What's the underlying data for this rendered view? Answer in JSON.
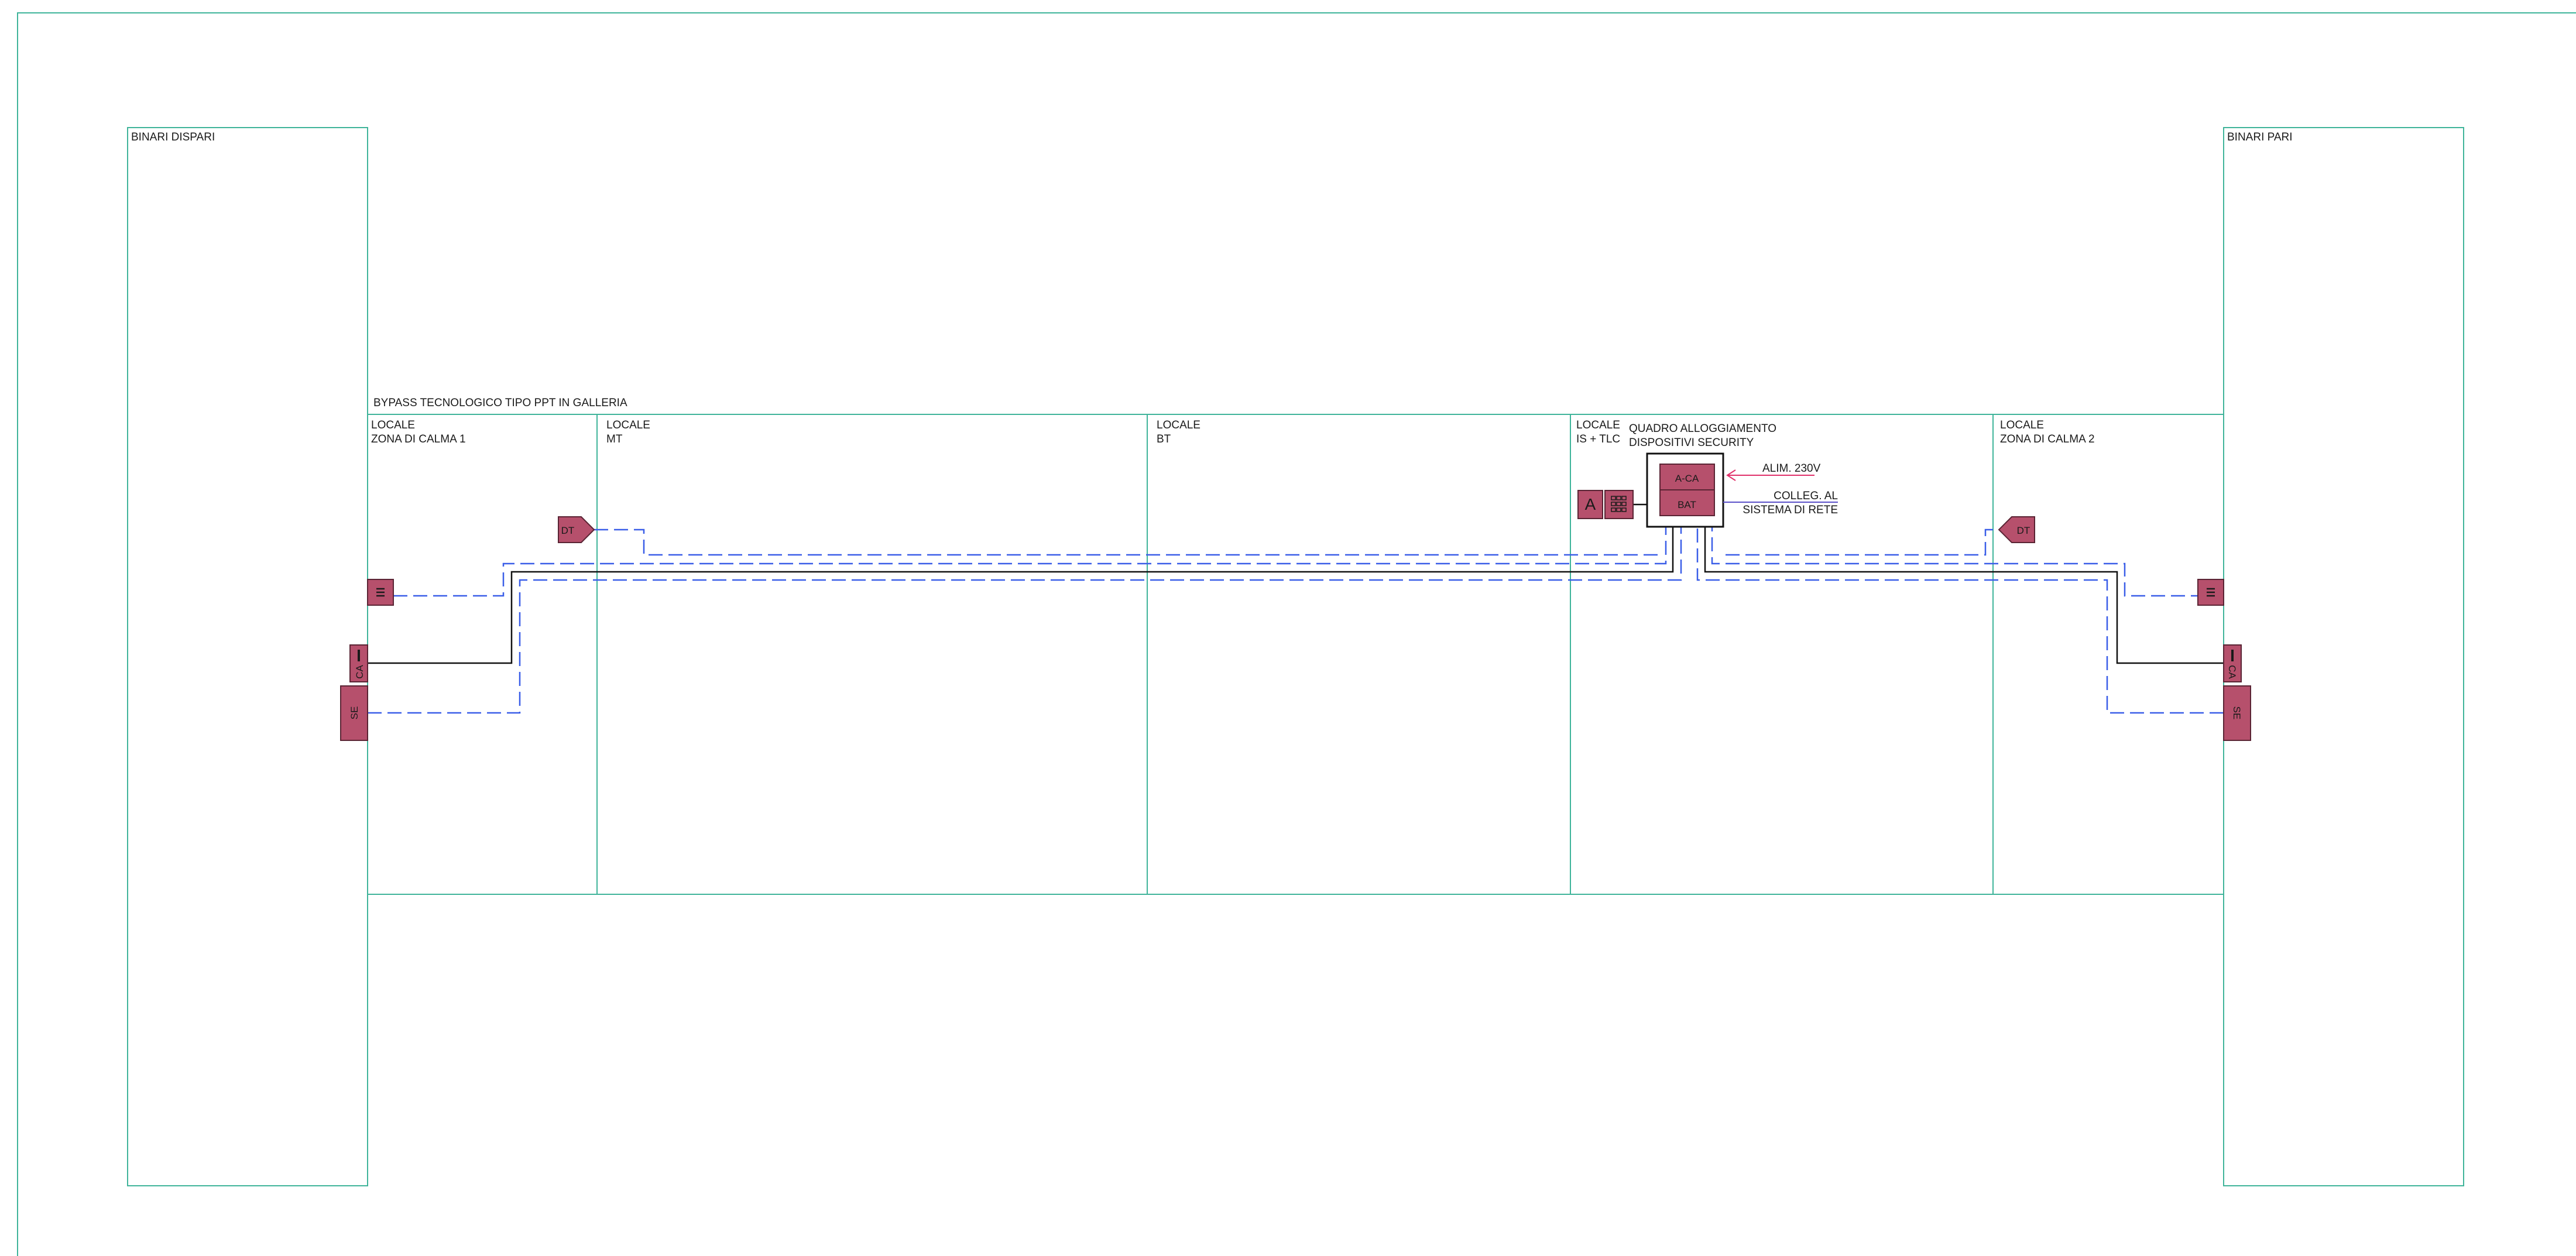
{
  "diagram": {
    "title": "BYPASS TECNOLOGICO TIPO PPT IN GALLERIA",
    "tracks": {
      "left": "BINARI DISPARI",
      "right": "BINARI PARI"
    },
    "rooms": [
      {
        "line1": "LOCALE",
        "line2": "ZONA DI CALMA 1"
      },
      {
        "line1": "LOCALE",
        "line2": "MT"
      },
      {
        "line1": "LOCALE",
        "line2": "BT"
      },
      {
        "line1": "LOCALE",
        "line2": "IS + TLC"
      },
      {
        "line1": "LOCALE",
        "line2": "ZONA DI CALMA 2"
      }
    ],
    "panel": {
      "title_line1": "QUADRO ALLOGGIAMENTO",
      "title_line2": "DISPOSITIVI SECURITY",
      "aca": "A-CA",
      "bat": "BAT",
      "alim": "ALIM. 230V",
      "colleg_line1": "COLLEG. AL",
      "colleg_line2": "SISTEMA DI RETE"
    },
    "devices": {
      "dt": "DT",
      "ca": "CA",
      "se": "SE",
      "a": "A"
    },
    "colors": {
      "frame": "#3fb49a",
      "device": "#b6506c",
      "dashed_line": "#3a5ee8",
      "power_arrow": "#e0306a",
      "net_line": "#5a50c8"
    }
  }
}
